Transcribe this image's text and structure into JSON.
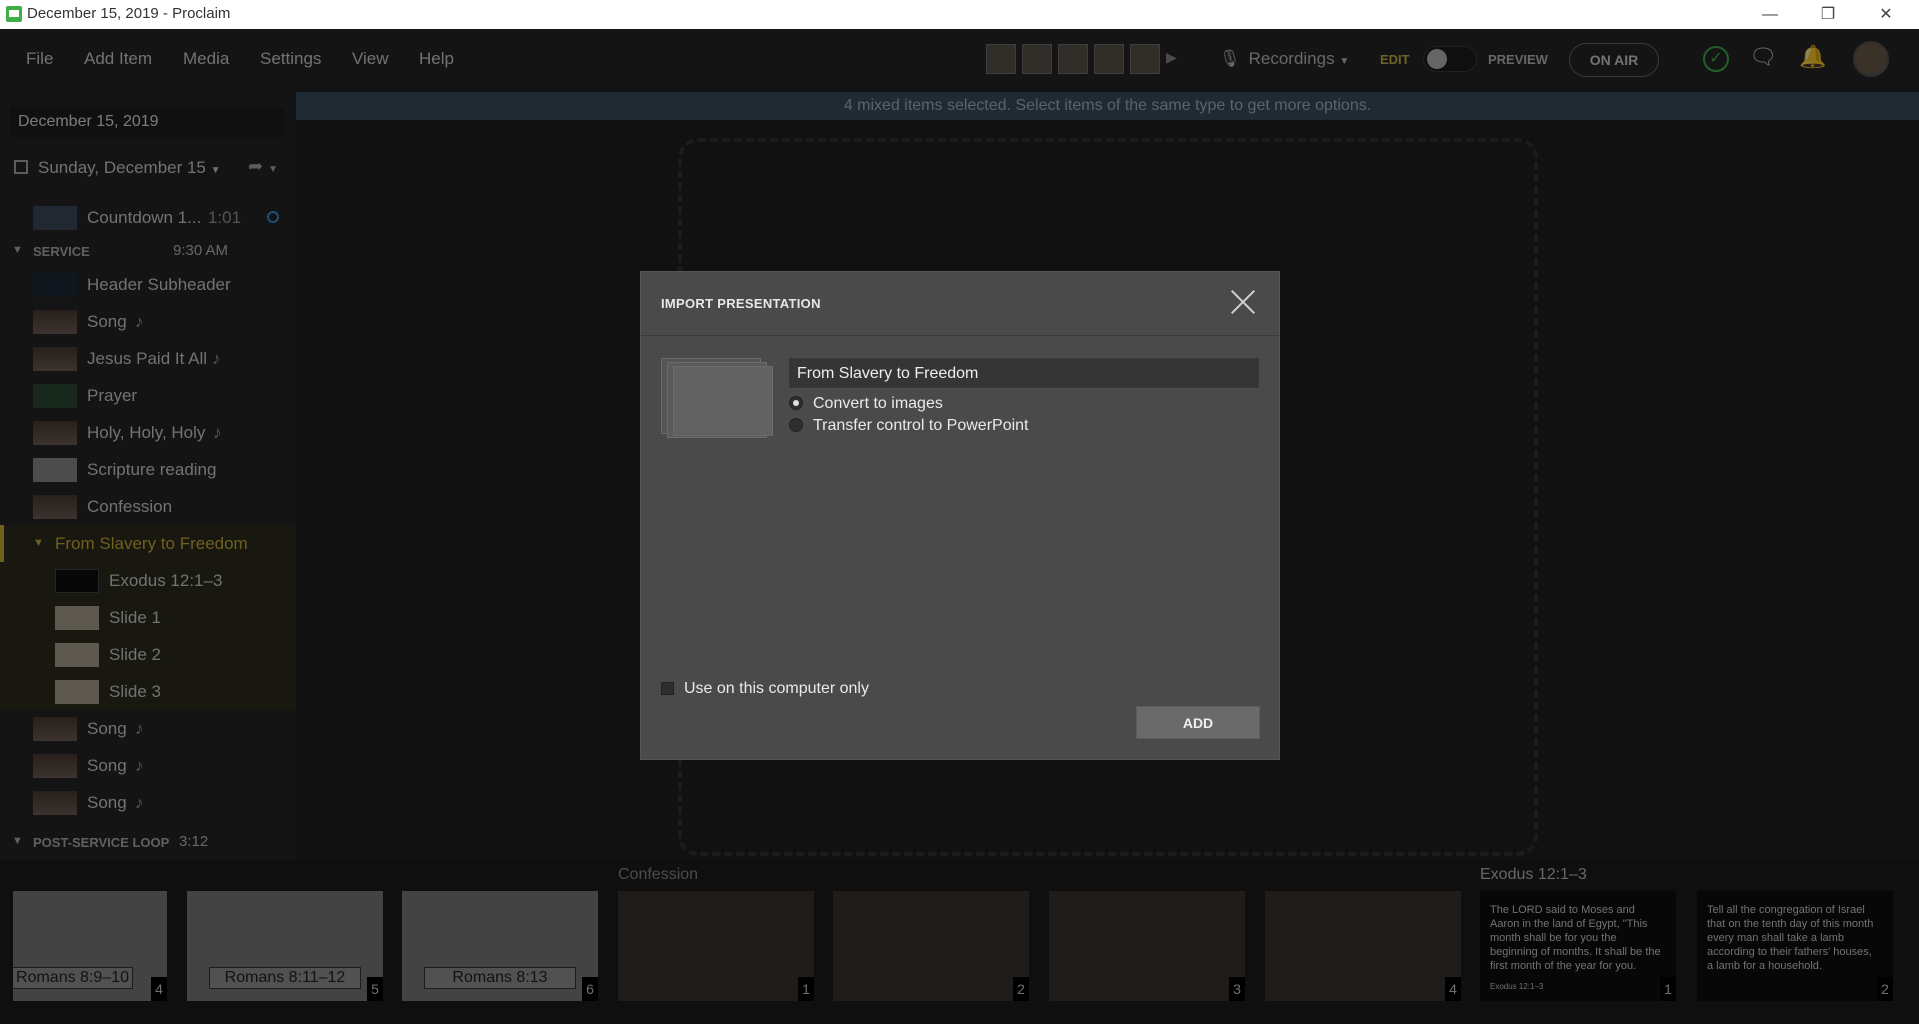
{
  "window": {
    "title": "December 15, 2019 - Proclaim"
  },
  "menu": [
    "File",
    "Add Item",
    "Media",
    "Settings",
    "View",
    "Help"
  ],
  "toolbar": {
    "recordings": "Recordings",
    "edit": "EDIT",
    "preview": "PREVIEW",
    "on_air": "ON AIR"
  },
  "sidebar": {
    "date_value": "December 15, 2019",
    "day": "Sunday, December 15",
    "pre_item": {
      "label": "Countdown 1...",
      "duration": "1:01"
    },
    "service": {
      "name": "SERVICE",
      "time": "9:30 AM"
    },
    "items": [
      {
        "label": "Header Subheader"
      },
      {
        "label": "Song"
      },
      {
        "label": "Jesus Paid It All"
      },
      {
        "label": "Prayer"
      },
      {
        "label": "Holy, Holy, Holy"
      },
      {
        "label": "Scripture reading"
      },
      {
        "label": "Confession"
      }
    ],
    "group": {
      "label": "From Slavery to Freedom",
      "children": [
        {
          "label": "Exodus 12:1–3"
        },
        {
          "label": "Slide 1"
        },
        {
          "label": "Slide 2"
        },
        {
          "label": "Slide 3"
        }
      ]
    },
    "after_items": [
      {
        "label": "Song"
      },
      {
        "label": "Song"
      },
      {
        "label": "Song"
      }
    ],
    "post": {
      "name": "POST-SERVICE LOOP",
      "time": "3:12"
    }
  },
  "main": {
    "info": "4 mixed items selected. Select items of the same type to get more options."
  },
  "modal": {
    "title": "IMPORT PRESENTATION",
    "name_value": "From Slavery to Freedom",
    "option_images": "Convert to images",
    "option_powerpoint": "Transfer control to PowerPoint",
    "selected_option": "Convert to images",
    "checkbox_label": "Use on this computer only",
    "checkbox_checked": false,
    "add_label": "ADD"
  },
  "filmstrip": {
    "romans": [
      {
        "caption": "Romans 8:9–10",
        "num": "4"
      },
      {
        "caption": "Romans 8:11–12",
        "num": "5"
      },
      {
        "caption": "Romans 8:13",
        "num": "6"
      }
    ],
    "confession_title": "Confession",
    "confession": [
      {
        "num": "1"
      },
      {
        "num": "2"
      },
      {
        "num": "3"
      },
      {
        "num": "4"
      }
    ],
    "exodus_title": "Exodus 12:1–3",
    "exodus": [
      {
        "text": "The LORD said to Moses and Aaron in the land of Egypt, \"This month shall be for you the beginning of months. It shall be the first month of the year for you.",
        "ref": "Exodus 12:1–3",
        "num": "1"
      },
      {
        "text": "Tell all the congregation of Israel that on the tenth day of this month every man shall take a lamb according to their fathers' houses, a lamb for a household.",
        "num": "2"
      }
    ]
  }
}
